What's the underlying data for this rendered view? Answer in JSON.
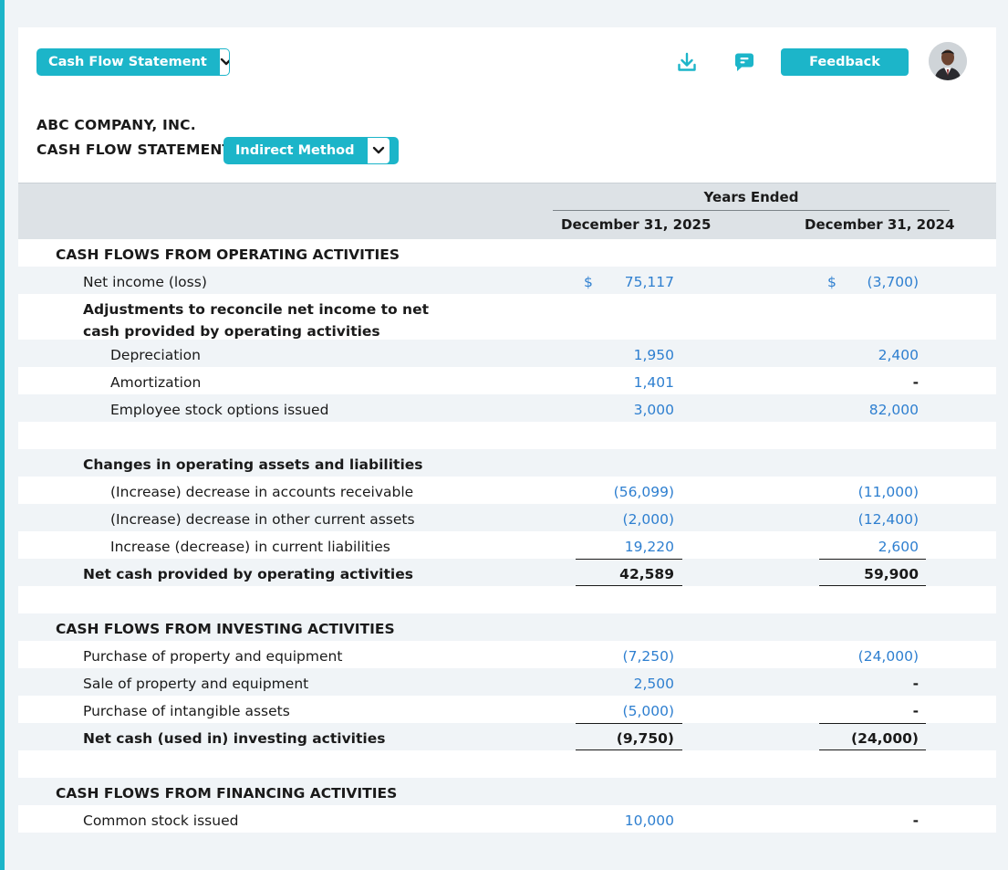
{
  "header": {
    "statement_select": "Cash Flow Statement",
    "feedback_label": "Feedback"
  },
  "company": {
    "name": "ABC COMPANY, INC.",
    "statement_title": "CASH FLOW STATEMENT",
    "method_select": "Indirect Method"
  },
  "table": {
    "group_header": "Years Ended",
    "col1": "December 31, 2025",
    "col2": "December 31, 2024",
    "currency": "$",
    "rows": {
      "op_header": "CASH FLOWS FROM OPERATING ACTIVITIES",
      "net_income": {
        "label": "Net income (loss)",
        "v1": "75,117",
        "v2": "(3,700)"
      },
      "adj_header": "Adjustments to reconcile net income to net cash provided by operating activities",
      "depreciation": {
        "label": "Depreciation",
        "v1": "1,950",
        "v2": "2,400"
      },
      "amortization": {
        "label": "Amortization",
        "v1": "1,401",
        "v2": "-"
      },
      "stock_options": {
        "label": "Employee stock options issued",
        "v1": "3,000",
        "v2": "82,000"
      },
      "changes_header": "Changes in operating assets and liabilities",
      "accounts_receivable": {
        "label": "(Increase) decrease in accounts receivable",
        "v1": "(56,099)",
        "v2": "(11,000)"
      },
      "other_current_assets": {
        "label": "(Increase) decrease in other current assets",
        "v1": "(2,000)",
        "v2": "(12,400)"
      },
      "current_liabilities": {
        "label": "Increase (decrease) in current liabilities",
        "v1": "19,220",
        "v2": "2,600"
      },
      "net_operating": {
        "label": "Net cash provided by operating activities",
        "v1": "42,589",
        "v2": "59,900"
      },
      "inv_header": "CASH FLOWS FROM INVESTING ACTIVITIES",
      "purchase_ppe": {
        "label": "Purchase of property and equipment",
        "v1": "(7,250)",
        "v2": "(24,000)"
      },
      "sale_ppe": {
        "label": "Sale of property and equipment",
        "v1": "2,500",
        "v2": "-"
      },
      "purchase_intangible": {
        "label": "Purchase of intangible assets",
        "v1": "(5,000)",
        "v2": "-"
      },
      "net_investing": {
        "label": "Net cash (used in) investing activities",
        "v1": "(9,750)",
        "v2": "(24,000)"
      },
      "fin_header": "CASH FLOWS FROM FINANCING ACTIVITIES",
      "common_stock": {
        "label": "Common stock issued",
        "v1": "10,000",
        "v2": "-"
      }
    }
  },
  "colors": {
    "accent": "#1cb5c9",
    "value_blue": "#2e7fd0",
    "header_bg": "#dde2e6",
    "row_alt": "#f0f4f7"
  },
  "icons": [
    "chevron-down-icon",
    "download-icon",
    "comment-icon",
    "avatar"
  ]
}
